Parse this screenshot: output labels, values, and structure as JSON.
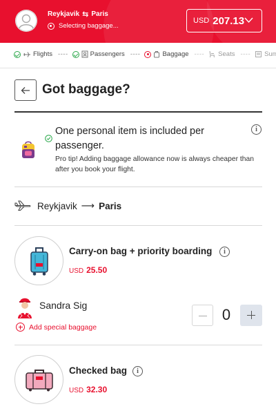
{
  "header": {
    "origin": "Reykjavik",
    "destination": "Paris",
    "route_arrow": "⇆",
    "status": "Selecting baggage...",
    "currency": "USD",
    "total": "207.13",
    "brand_color": "#e8102e"
  },
  "steps": [
    {
      "label": "Flights",
      "state": "done"
    },
    {
      "label": "Passengers",
      "state": "done"
    },
    {
      "label": "Baggage",
      "state": "current"
    },
    {
      "label": "Seats",
      "state": "future"
    },
    {
      "label": "Summa",
      "state": "future"
    }
  ],
  "page": {
    "title": "Got baggage?"
  },
  "info": {
    "headline": "One personal item is included per passenger.",
    "tip": "Pro tip! Adding baggage allowance now is always cheaper than after you book your flight."
  },
  "route": {
    "from": "Reykjavik",
    "arrow": "⟶",
    "to": "Paris"
  },
  "carry_on": {
    "title": "Carry-on bag + priority boarding",
    "currency": "USD",
    "price": "25.50"
  },
  "passenger": {
    "name": "Sandra Sig",
    "add_special": "Add special baggage",
    "quantity": "0"
  },
  "checked": {
    "title": "Checked bag",
    "currency": "USD",
    "price": "32.30"
  }
}
